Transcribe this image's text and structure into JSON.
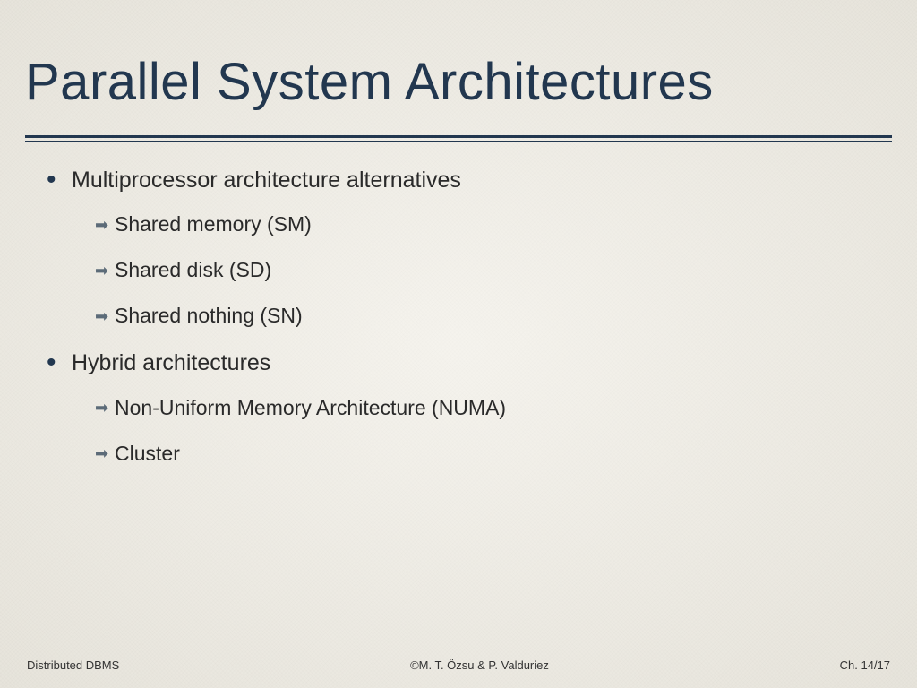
{
  "title": "Parallel System Architectures",
  "bullets": [
    {
      "text": "Multiprocessor architecture alternatives",
      "subs": [
        "Shared memory (SM)",
        "Shared disk (SD)",
        "Shared nothing (SN)"
      ]
    },
    {
      "text": "Hybrid architectures",
      "subs": [
        "Non-Uniform Memory Architecture (NUMA)",
        "Cluster"
      ]
    }
  ],
  "footer": {
    "left": "Distributed DBMS",
    "center": "©M. T. Özsu & P. Valduriez",
    "right": "Ch. 14/17"
  }
}
